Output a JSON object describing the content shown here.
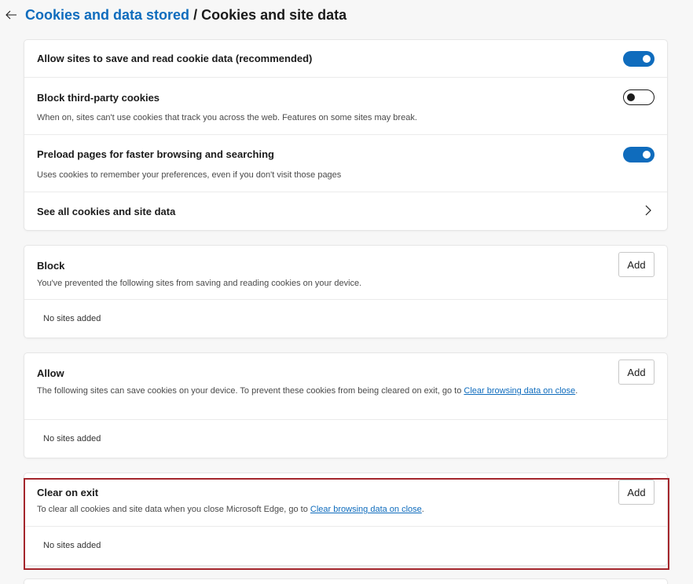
{
  "header": {
    "back_icon": "back-arrow-icon",
    "parent": "Cookies and data stored",
    "separator": "/",
    "current": "Cookies and site data"
  },
  "settings": {
    "allow_cookies": {
      "title": "Allow sites to save and read cookie data (recommended)",
      "state": "on"
    },
    "block_third_party": {
      "title": "Block third-party cookies",
      "desc": "When on, sites can't use cookies that track you across the web. Features on some sites may break.",
      "state": "off"
    },
    "preload": {
      "title": "Preload pages for faster browsing and searching",
      "desc": "Uses cookies to remember your preferences, even if you don't visit those pages",
      "state": "on"
    },
    "see_all": {
      "title": "See all cookies and site data",
      "icon": "chevron-right-icon"
    }
  },
  "block": {
    "title": "Block",
    "desc": "You've prevented the following sites from saving and reading cookies on your device.",
    "add_label": "Add",
    "empty": "No sites added"
  },
  "allow": {
    "title": "Allow",
    "desc_before": "The following sites can save cookies on your device. To prevent these cookies from being cleared on exit, go to ",
    "link": "Clear browsing data on close",
    "desc_after": ".",
    "add_label": "Add",
    "empty": "No sites added"
  },
  "clear_on_exit": {
    "title": "Clear on exit",
    "desc_before": "To clear all cookies and site data when you close Microsoft Edge, go to ",
    "link": "Clear browsing data on close",
    "desc_after": ".",
    "add_label": "Add",
    "empty": "No sites added"
  },
  "colors": {
    "accent": "#0f6cbd",
    "highlight": "#a4262c"
  }
}
